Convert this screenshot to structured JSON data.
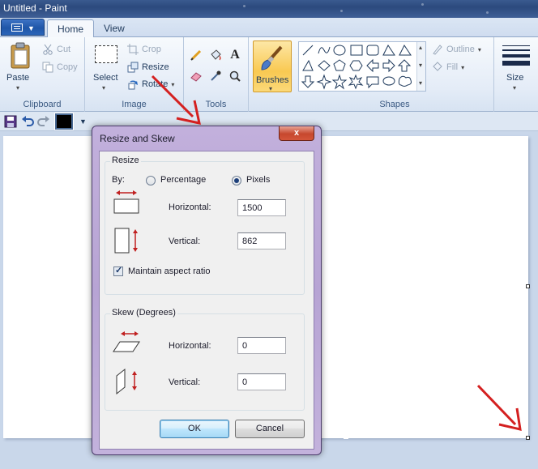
{
  "window": {
    "title": "Untitled - Paint"
  },
  "tabs": [
    {
      "label": "Home"
    },
    {
      "label": "View"
    }
  ],
  "ribbon": {
    "clipboard": {
      "paste": "Paste",
      "cut": "Cut",
      "copy": "Copy",
      "group_label": "Clipboard"
    },
    "image": {
      "select": "Select",
      "crop": "Crop",
      "resize": "Resize",
      "rotate": "Rotate",
      "group_label": "Image"
    },
    "tools": {
      "group_label": "Tools",
      "text_tool_glyph": "A"
    },
    "brushes": {
      "label": "Brushes"
    },
    "shapes": {
      "outline": "Outline",
      "fill": "Fill",
      "group_label": "Shapes"
    },
    "size": {
      "label": "Size"
    }
  },
  "quick_access": {
    "current_color": "#000000"
  },
  "dialog": {
    "title": "Resize and Skew",
    "close_glyph": "x",
    "resize": {
      "legend": "Resize",
      "by_label": "By:",
      "percentage_label": "Percentage",
      "pixels_label": "Pixels",
      "selected_unit": "Pixels",
      "horizontal_label": "Horizontal:",
      "horizontal_value": "1500",
      "vertical_label": "Vertical:",
      "vertical_value": "862",
      "maintain_aspect_label": "Maintain aspect ratio",
      "maintain_aspect_checked": true
    },
    "skew": {
      "legend": "Skew (Degrees)",
      "horizontal_label": "Horizontal:",
      "horizontal_value": "0",
      "vertical_label": "Vertical:",
      "vertical_value": "0"
    },
    "ok_label": "OK",
    "cancel_label": "Cancel"
  },
  "annotation_color": "#d42020"
}
